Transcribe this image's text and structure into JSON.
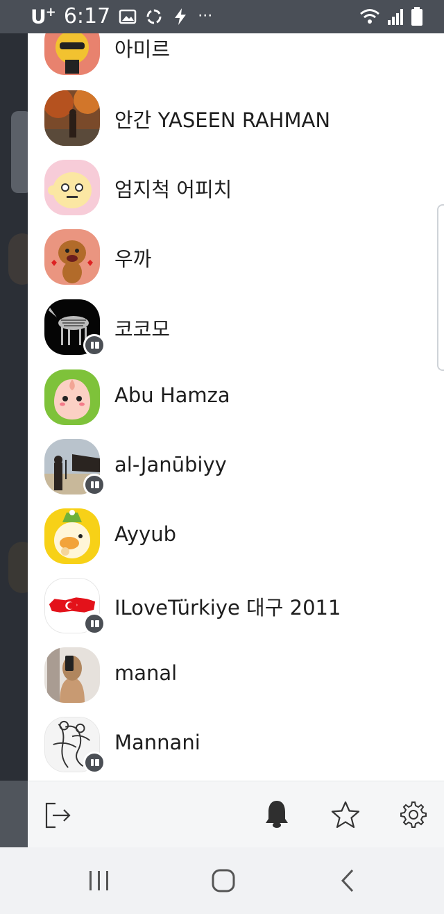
{
  "status_bar": {
    "carrier": "U",
    "carrier_sup": "+",
    "time": "6:17",
    "more": "···"
  },
  "contacts": [
    {
      "name": "아미르",
      "avatar": "bear-sunglasses-avatar",
      "badge": false
    },
    {
      "name": "안간 YASEEN RAHMAN",
      "avatar": "autumn-photo-avatar",
      "badge": false
    },
    {
      "name": "엄지척 어피치",
      "avatar": "apeach-thumbs-avatar",
      "badge": false
    },
    {
      "name": "우까",
      "avatar": "dog-character-avatar",
      "badge": false
    },
    {
      "name": "코코모",
      "avatar": "zebra-xray-avatar",
      "badge": true
    },
    {
      "name": "Abu Hamza",
      "avatar": "apeach-green-avatar",
      "badge": false
    },
    {
      "name": "al-Janūbiyy",
      "avatar": "desert-photo-avatar",
      "badge": true
    },
    {
      "name": "Ayyub",
      "avatar": "tube-character-avatar",
      "badge": false
    },
    {
      "name": "ILoveTürkiye 대구 2011",
      "avatar": "turkey-map-avatar",
      "badge": true
    },
    {
      "name": "manal",
      "avatar": "mirror-selfie-avatar",
      "badge": false
    },
    {
      "name": "Mannani",
      "avatar": "sketch-drawing-avatar",
      "badge": true
    }
  ],
  "footer": {
    "icons": [
      "logout-icon",
      "bell-icon",
      "star-icon",
      "settings-icon"
    ]
  },
  "nav": {
    "icons": [
      "recent-apps-icon",
      "home-icon",
      "back-icon"
    ]
  }
}
